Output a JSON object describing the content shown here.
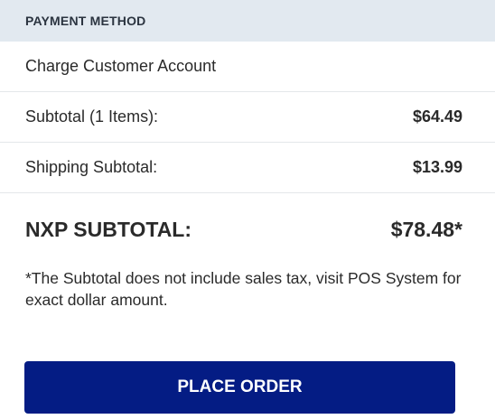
{
  "header": {
    "title": "PAYMENT METHOD"
  },
  "payment_method": {
    "label": "Charge Customer Account"
  },
  "summary": {
    "subtotal_label": "Subtotal (1 Items):",
    "subtotal_value": "$64.49",
    "shipping_label": "Shipping Subtotal:",
    "shipping_value": "$13.99",
    "total_label": "NXP SUBTOTAL:",
    "total_value": "$78.48*"
  },
  "note": {
    "text": "*The Subtotal does not include sales tax, visit POS System for exact dollar amount."
  },
  "actions": {
    "place_order_label": "PLACE ORDER"
  },
  "colors": {
    "header_bg": "#e2e9f0",
    "button_bg": "#041c84",
    "button_text": "#ffffff"
  }
}
